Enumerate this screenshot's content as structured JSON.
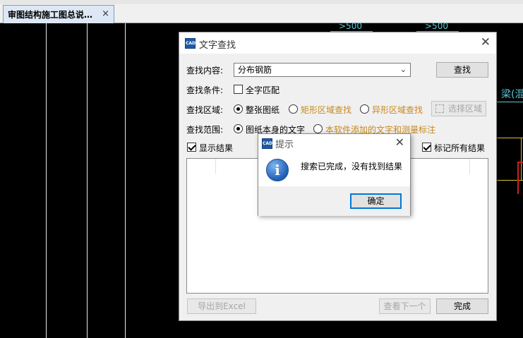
{
  "tab": {
    "label": "审图结构施工图总说…",
    "close": "×"
  },
  "canvas": {
    "texts": [
      ">500",
      ">500",
      "梁(混"
    ]
  },
  "find_dialog": {
    "title": "文字查找",
    "close": "✕",
    "content_label": "查找内容:",
    "content_value": "分布钢筋",
    "find_button": "查找",
    "condition_label": "查找条件:",
    "whole_word": "全字匹配",
    "area_label": "查找区域:",
    "area_options": [
      "整张图纸",
      "矩形区域查找",
      "异形区域查找"
    ],
    "select_area_button": "选择区域",
    "scope_label": "查找范围:",
    "scope_options": [
      "图纸本身的文字",
      "本软件添加的文字和测量标注"
    ],
    "show_results": "显示结果",
    "mark_all": "标记所有结果",
    "export_button": "导出到Excel",
    "next_button": "查看下一个",
    "done_button": "完成"
  },
  "message_box": {
    "title": "提示",
    "close": "✕",
    "message": "搜索已完成，没有找到结果",
    "ok_button": "确定"
  },
  "colors": {
    "accent": "#0078d7",
    "disabled_orange": "#c8881e",
    "cad_cyan": "#5ec8d8"
  }
}
